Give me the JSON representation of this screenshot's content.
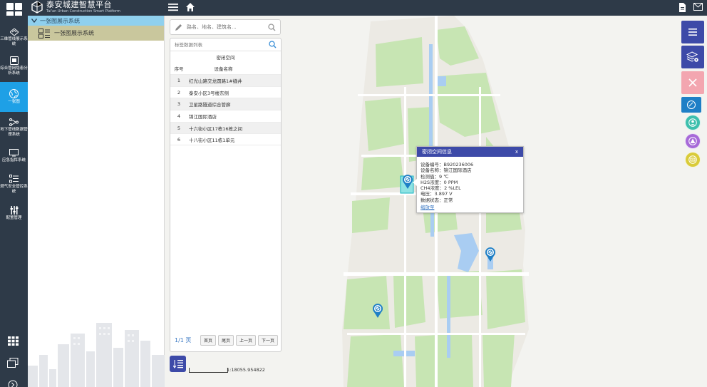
{
  "app": {
    "title_cn": "泰安城建智慧平台",
    "title_en": "Tai'an Urban Construction Smart Platform"
  },
  "sidebar": {
    "items": [
      {
        "label": "三维管线展示系统",
        "icon": "cube-outline-icon"
      },
      {
        "label": "综合管网隐患分析系统",
        "icon": "document-chart-icon"
      },
      {
        "label": "一张图",
        "icon": "globe-icon",
        "active": true
      },
      {
        "label": "地下管线数据管理系统",
        "icon": "network-icon"
      },
      {
        "label": "应急指挥系统",
        "icon": "monitor-icon"
      },
      {
        "label": "燃气安全管控系统",
        "icon": "list-icon"
      },
      {
        "label": "配置管理",
        "icon": "sliders-icon"
      }
    ],
    "bottom_icons": [
      "apps-grid-icon",
      "windows-icon",
      "arrow-circle-icon"
    ]
  },
  "tree": {
    "root_label": "一张图展示系统",
    "child_label": "一张图展示系统"
  },
  "search": {
    "placeholder": "路名、地名、建筑名..."
  },
  "list": {
    "filter_placeholder": "标签数据列表",
    "title": "密闭空间",
    "columns": [
      "序号",
      "设备名称"
    ],
    "rows": [
      {
        "no": "1",
        "name": "红光山路交龙圆路1#缝井"
      },
      {
        "no": "2",
        "name": "泰安小区3号楼东侧"
      },
      {
        "no": "3",
        "name": "卫星路隧道综合管廊"
      },
      {
        "no": "4",
        "name": "锦江国际酒店"
      },
      {
        "no": "5",
        "name": "十六街小区17栋16栋之间"
      },
      {
        "no": "6",
        "name": "十八街小区11栋1单元"
      }
    ],
    "pager": {
      "info": "1/1 页",
      "first": "首页",
      "last": "尾页",
      "prev": "上一页",
      "next": "下一页"
    }
  },
  "popup": {
    "title": "密闭空间信息",
    "close": "x",
    "fields": [
      {
        "k": "设备编号",
        "v": "B920236006"
      },
      {
        "k": "设备名称",
        "v": "锦江国际酒店"
      },
      {
        "k": "检测值",
        "v": "9 ℃"
      },
      {
        "k": "H2S浓度",
        "v": "0 PPM"
      },
      {
        "k": "CH4浓度",
        "v": "2 %LEL"
      },
      {
        "k": "电压",
        "v": "3.897 V"
      },
      {
        "k": "数据状态",
        "v": "正常"
      }
    ],
    "link": "缩放至"
  },
  "scale": {
    "text": "1:18055.954822"
  },
  "colors": {
    "nav_dark": "#2e3a48",
    "active_blue": "#1ea0e6",
    "accent_indigo": "#3d4aa8",
    "park_green": "#c7e5b3",
    "water_blue": "#a9cdf2",
    "close_pink": "#f3a6b0"
  }
}
